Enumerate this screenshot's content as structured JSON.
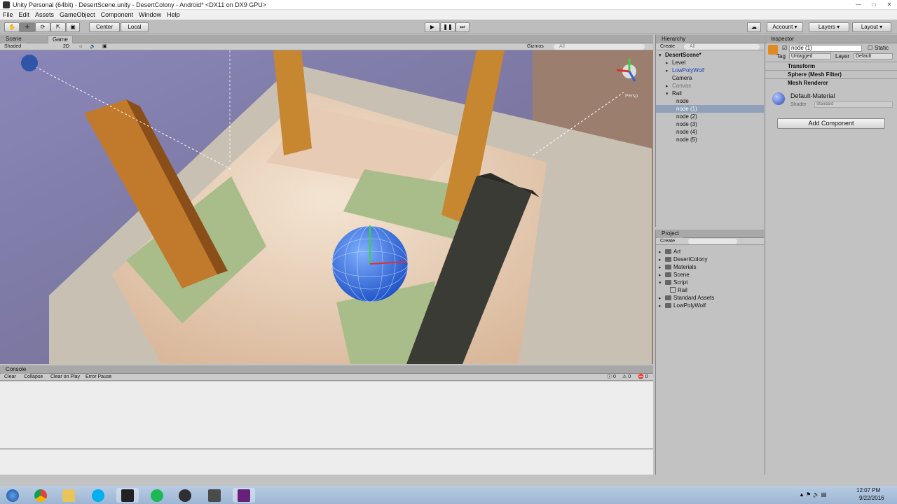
{
  "window": {
    "title": "Unity Personal (64bit) - DesertScene.unity - DesertColony - Android* <DX11 on DX9 GPU>"
  },
  "menu": [
    "File",
    "Edit",
    "Assets",
    "GameObject",
    "Component",
    "Window",
    "Help"
  ],
  "toolbar": {
    "tools": [
      "hand-tool",
      "move-tool",
      "rotate-tool",
      "scale-tool",
      "rect-tool"
    ],
    "pivot_label": "Center",
    "space_label": "Local",
    "account_label": "Account",
    "layers_label": "Layers",
    "layout_label": "Layout"
  },
  "scene": {
    "tab_scene": "Scene",
    "tab_game": "Game",
    "shading": "Shaded",
    "mode_2d": "2D",
    "gizmos_label": "Gizmos",
    "search_placeholder": "All",
    "persp_label": "Persp"
  },
  "hierarchy": {
    "title": "Hierarchy",
    "create_label": "Create",
    "search_placeholder": "All",
    "scene_name": "DesertScene*",
    "items": [
      {
        "label": "Level",
        "style": "normal"
      },
      {
        "label": "LowPolyWolf",
        "style": "prefab"
      },
      {
        "label": "Camera",
        "style": "normal"
      },
      {
        "label": "Canvas",
        "style": "inactive"
      },
      {
        "label": "Rail",
        "style": "normal"
      },
      {
        "label": "node",
        "style": "normal"
      },
      {
        "label": "node (1)",
        "style": "selected"
      },
      {
        "label": "node (2)",
        "style": "normal"
      },
      {
        "label": "node (3)",
        "style": "normal"
      },
      {
        "label": "node (4)",
        "style": "normal"
      },
      {
        "label": "node (5)",
        "style": "normal"
      }
    ]
  },
  "project": {
    "title": "Project",
    "create_label": "Create",
    "items": [
      "Art",
      "DesertColony",
      "Materials",
      "Scene",
      "Script",
      "Rail",
      "Standard Assets",
      "LowPolyWolf"
    ]
  },
  "inspector": {
    "title": "Inspector",
    "object_name": "node (1)",
    "static_label": "Static",
    "tag_label": "Tag",
    "tag_value": "Untagged",
    "layer_label": "Layer",
    "layer_value": "Default",
    "components": [
      "Transform",
      "Sphere (Mesh Filter)",
      "Mesh Renderer"
    ],
    "material_name": "Default-Material",
    "shader_label": "Shader",
    "shader_value": "Standard",
    "add_component_label": "Add Component"
  },
  "console": {
    "title": "Console",
    "buttons": [
      "Clear",
      "Collapse",
      "Clear on Play",
      "Error Pause"
    ],
    "counts": [
      "0",
      "0",
      "0"
    ]
  },
  "taskbar": {
    "time": "12:07 PM",
    "date": "9/22/2016",
    "apps": [
      "start",
      "chrome",
      "explorer",
      "skype",
      "unity",
      "spotify",
      "obs",
      "sublime",
      "visual-studio"
    ]
  },
  "colors": {
    "accent": "#3d6bbf",
    "selection": "#8fa0b8",
    "prefab_text": "#1a3fb0"
  }
}
